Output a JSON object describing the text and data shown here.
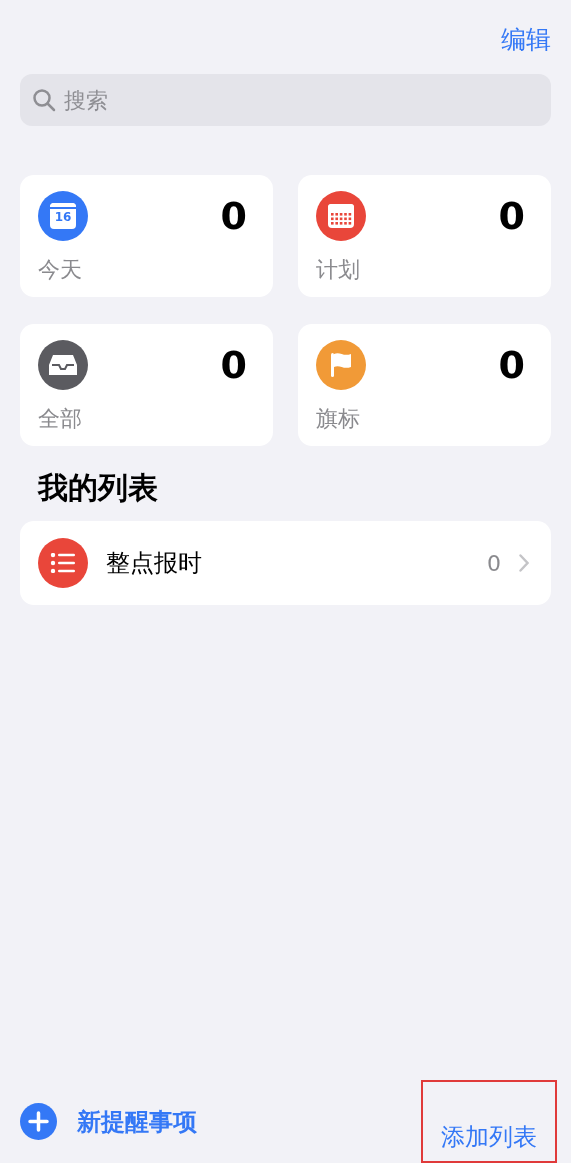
{
  "header": {
    "edit": "编辑"
  },
  "search": {
    "placeholder": "搜索"
  },
  "smart_lists": [
    {
      "kind": "today",
      "label": "今天",
      "count": "0",
      "icon_text": "16",
      "color": "#3478f6"
    },
    {
      "kind": "scheduled",
      "label": "计划",
      "count": "0",
      "color": "#e9463a"
    },
    {
      "kind": "all",
      "label": "全部",
      "count": "0",
      "color": "#5b5b60"
    },
    {
      "kind": "flagged",
      "label": "旗标",
      "count": "0",
      "color": "#f19a37"
    }
  ],
  "my_lists": {
    "title": "我的列表",
    "items": [
      {
        "name": "整点报时",
        "count": "0",
        "color": "#e9463a"
      }
    ]
  },
  "toolbar": {
    "new_reminder": "新提醒事项",
    "add_list": "添加列表"
  }
}
